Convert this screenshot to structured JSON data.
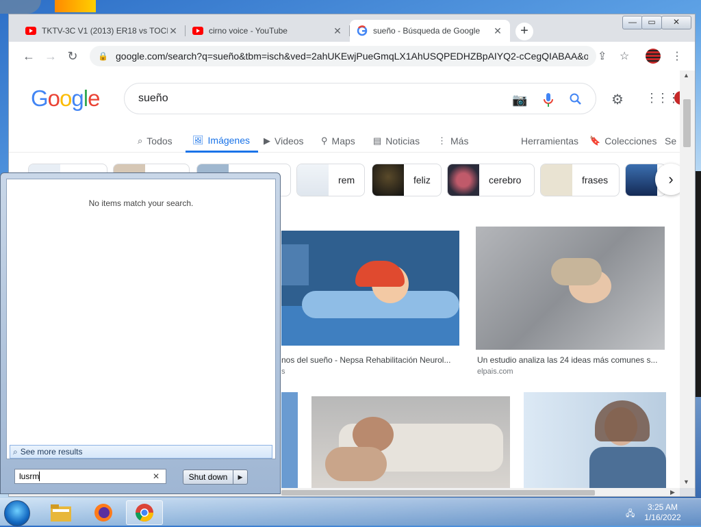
{
  "browser": {
    "tabs": [
      {
        "title": "TKTV-3C V1 (2013) ER18 vs TOCI",
        "icon": "youtube-icon",
        "active": false
      },
      {
        "title": "cirno voice - YouTube",
        "icon": "youtube-icon",
        "active": false
      },
      {
        "title": "sueño - Búsqueda de Google",
        "icon": "google-icon",
        "active": true
      }
    ],
    "new_tab": "+",
    "window_controls": {
      "minimize": "—",
      "maximize": "▭",
      "close": "✕"
    },
    "url": "google.com/search?q=sueño&tbm=isch&ved=2ahUKEwjPueGmqLX1AhUSQPEDHZBpAIYQ2-cCegQIABAA&oq..."
  },
  "google": {
    "logo": "Google",
    "query": "sueño",
    "nav_tabs": [
      {
        "label": "Todos",
        "icon": "search-icon",
        "active": false
      },
      {
        "label": "Imágenes",
        "icon": "image-icon",
        "active": true
      },
      {
        "label": "Videos",
        "icon": "play-icon",
        "active": false
      },
      {
        "label": "Maps",
        "icon": "pin-icon",
        "active": false
      },
      {
        "label": "Noticias",
        "icon": "news-icon",
        "active": false
      },
      {
        "label": "Más",
        "icon": "more-icon",
        "active": false
      }
    ],
    "tools": "Herramientas",
    "collections": "Colecciones",
    "safe_search": "Se",
    "chips": [
      "rem",
      "feliz",
      "cerebro",
      "frases"
    ],
    "results": [
      {
        "caption": "nos del sueño - Nepsa Rehabilitación Neurol...",
        "source": "s"
      },
      {
        "caption": "Un estudio analiza las 24 ideas más comunes s...",
        "source": "elpais.com"
      }
    ]
  },
  "start_menu": {
    "no_items": "No items match your search.",
    "see_more": "See more results",
    "search_value": "lusrm",
    "shutdown": "Shut down"
  },
  "taskbar": {
    "time": "3:25 AM",
    "date": "1/16/2022"
  }
}
